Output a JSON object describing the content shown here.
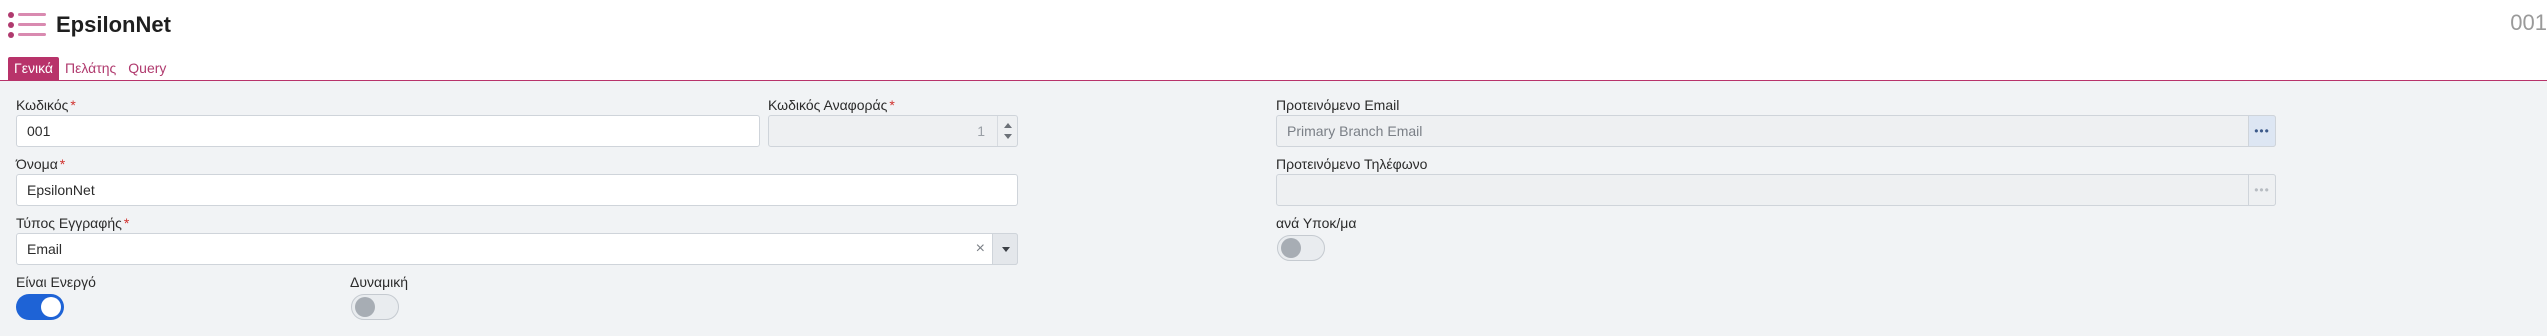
{
  "header": {
    "menu_icon": "hamburger-list-icon",
    "title": "EpsilonNet",
    "record_id": "001"
  },
  "tabs": [
    {
      "label": "Γενικά",
      "active": true
    },
    {
      "label": "Πελάτης",
      "active": false
    },
    {
      "label": "Query",
      "active": false
    }
  ],
  "form": {
    "code": {
      "label": "Κωδικός",
      "required_mark": "*",
      "value": "001"
    },
    "ref_code": {
      "label": "Κωδικός Αναφοράς",
      "required_mark": "*",
      "value": "1"
    },
    "name": {
      "label": "Όνομα",
      "required_mark": "*",
      "value": "EpsilonNet"
    },
    "record_type": {
      "label": "Τύπος Εγγραφής",
      "required_mark": "*",
      "value": "Email",
      "clear_glyph": "×"
    },
    "is_active": {
      "label": "Είναι Ενεργό",
      "on": true
    },
    "dynamic": {
      "label": "Δυναμική",
      "on": false
    },
    "suggested_email": {
      "label": "Προτεινόμενο Email",
      "placeholder": "Primary Branch Email",
      "button_glyph": "•••"
    },
    "suggested_phone": {
      "label": "Προτεινόμενο Τηλέφωνο",
      "value": "",
      "button_glyph": "•••"
    },
    "per_branch": {
      "label": "ανά Υποκ/μα",
      "on": false
    }
  },
  "colors": {
    "accent": "#b8336a",
    "toggle_on": "#1e63d6",
    "required": "#d0312d",
    "form_background": "#f1f3f5"
  }
}
